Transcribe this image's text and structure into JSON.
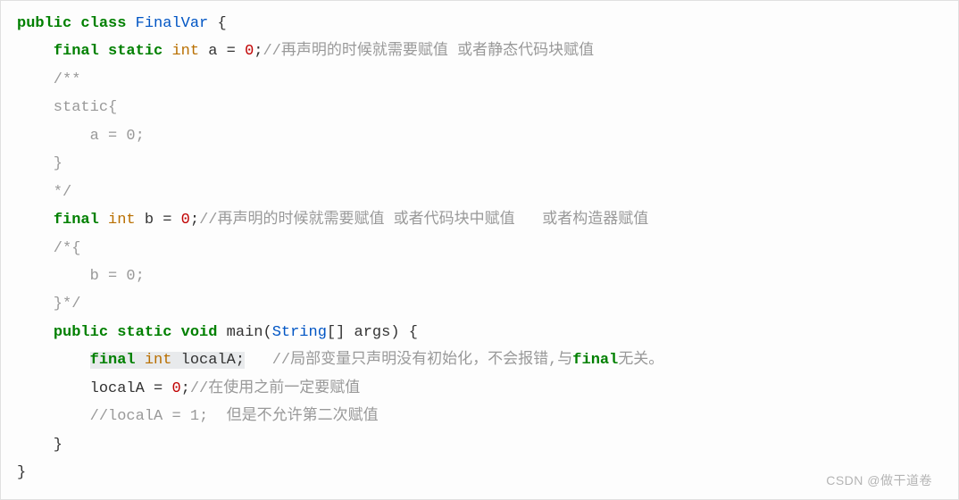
{
  "code": {
    "l1_kw1": "public",
    "l1_kw2": "class",
    "l1_cls": "FinalVar",
    "l1_brace": " {",
    "l2_indent": "    ",
    "l2_kw1": "final",
    "l2_kw2": "static",
    "l2_type": "int",
    "l2_var": " a = ",
    "l2_num": "0",
    "l2_semi": ";",
    "l2_comment": "//再声明的时候就需要赋值 或者静态代码块赋值",
    "l3": "    /**",
    "l4": "    static{",
    "l5": "        a = 0;",
    "l6": "    }",
    "l7": "    */",
    "l8_indent": "    ",
    "l8_kw1": "final",
    "l8_type": "int",
    "l8_var": " b = ",
    "l8_num": "0",
    "l8_semi": ";",
    "l8_comment": "//再声明的时候就需要赋值 或者代码块中赋值   或者构造器赋值",
    "l9": "    /*{",
    "l10": "        b = 0;",
    "l11": "    }*/",
    "l12_indent": "    ",
    "l12_kw1": "public",
    "l12_kw2": "static",
    "l12_kw3": "void",
    "l12_fn": " main(",
    "l12_cls": "String",
    "l12_params": "[] args) {",
    "l13_indent": "        ",
    "l13_kw": "final",
    "l13_type": "int",
    "l13_var": " localA;",
    "l13_gap": "   ",
    "l13_c1": "//局部变量只声明没有初始化，不会报错,与",
    "l13_c_kw": "final",
    "l13_c2": "无关。",
    "l14_indent": "        localA = ",
    "l14_num": "0",
    "l14_semi": ";",
    "l14_comment": "//在使用之前一定要赋值",
    "l15_pre": "        ",
    "l15_c1": "//localA = 1;  但是不允许第二次赋值",
    "l16": "    }",
    "l17": "}"
  },
  "watermark": "CSDN @做干道卷"
}
